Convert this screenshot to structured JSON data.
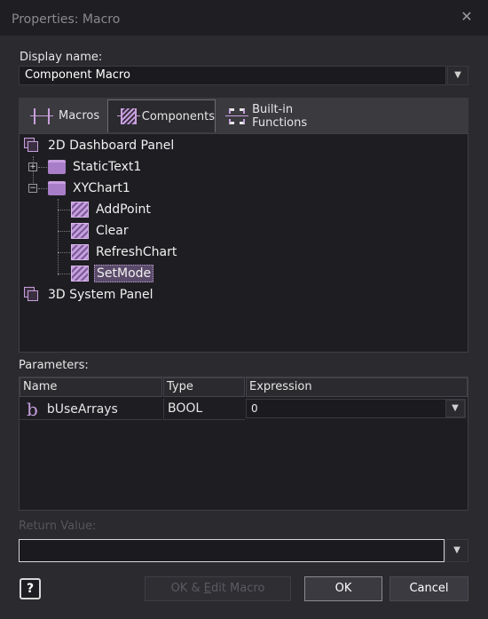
{
  "window": {
    "title": "Properties: Macro",
    "close_icon": "close-icon"
  },
  "display_name": {
    "label": "Display name:",
    "value": "Component Macro"
  },
  "tabs": [
    {
      "label": "Macros",
      "icon": "macros-icon"
    },
    {
      "label": "Components",
      "icon": "components-icon",
      "selected": true
    },
    {
      "label": "Built-in Functions",
      "icon": "builtin-functions-icon"
    }
  ],
  "tree": {
    "root1": {
      "label": "2D Dashboard Panel",
      "icon": "panel-icon"
    },
    "statictext": {
      "label": "StaticText1",
      "icon": "folder-icon",
      "expander": "+"
    },
    "xychart": {
      "label": "XYChart1",
      "icon": "folder-icon",
      "expander": "−"
    },
    "items": [
      {
        "label": "AddPoint",
        "icon": "macro-icon"
      },
      {
        "label": "Clear",
        "icon": "macro-icon"
      },
      {
        "label": "RefreshChart",
        "icon": "macro-icon"
      },
      {
        "label": "SetMode",
        "icon": "macro-icon",
        "selected": true
      }
    ],
    "root2": {
      "label": "3D System Panel",
      "icon": "panel-icon"
    }
  },
  "parameters": {
    "label": "Parameters:",
    "columns": {
      "name": "Name",
      "type": "Type",
      "expression": "Expression"
    },
    "rows": [
      {
        "icon": "b",
        "name": "bUseArrays",
        "type": "BOOL",
        "expression": "0"
      }
    ]
  },
  "return_value": {
    "label": "Return Value:",
    "value": ""
  },
  "buttons": {
    "help": "?",
    "ok_edit_pre": "OK & ",
    "ok_edit_u": "E",
    "ok_edit_post": "dit Macro",
    "ok": "OK",
    "cancel": "Cancel"
  },
  "colors": {
    "accent": "#c79fe0",
    "background": "#2b2b2f",
    "panel": "#1e1e22"
  }
}
